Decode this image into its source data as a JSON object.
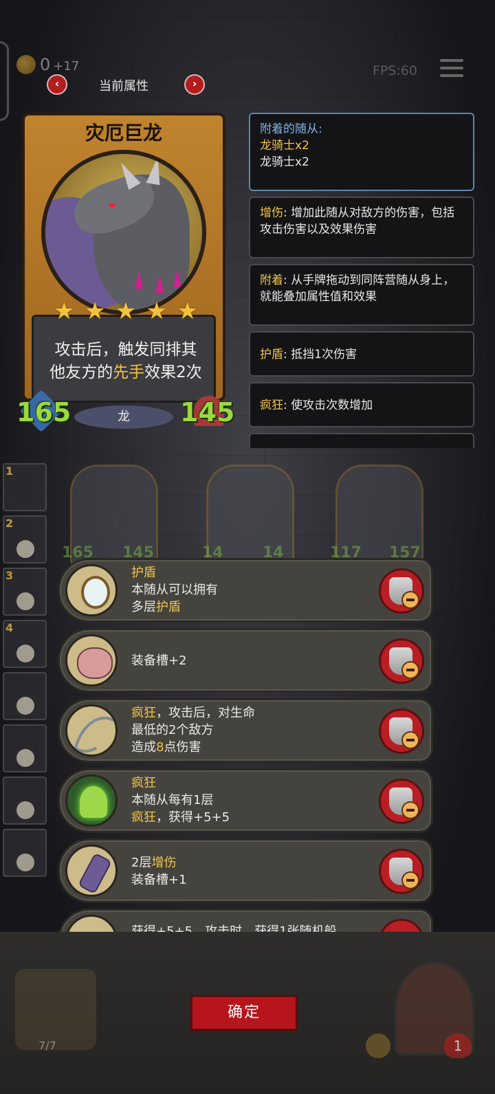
{
  "topbar": {
    "coins": "0",
    "coins_plus": "+17",
    "fps": "FPS:60"
  },
  "nav": {
    "prev": "‹",
    "title": "当前属性",
    "next": "›"
  },
  "hero": {
    "name": "灾厄巨龙",
    "stars": [
      "★",
      "★",
      "★",
      "★",
      "★"
    ],
    "desc_part1": "攻击后，触发同排其",
    "desc_part2": "他友方的",
    "desc_highlight": "先手",
    "desc_part3": "效果2次",
    "attack": "165",
    "health": "145",
    "tribe": "龙"
  },
  "info": [
    {
      "key": "附着的随从:",
      "lines": [
        "龙骑士x2",
        "龙骑士x2"
      ]
    },
    {
      "key": "增伤",
      "text": ": 增加此随从对敌方的伤害，包括攻击伤害以及效果伤害"
    },
    {
      "key": "附着",
      "text": ": 从手牌拖动到同阵营随从身上，就能叠加属性值和效果"
    },
    {
      "key": "护盾",
      "text": ": 抵挡1次伤害"
    },
    {
      "key": "疯狂",
      "text": ": 使攻击次数增加"
    }
  ],
  "team": [
    "1",
    "2",
    "3",
    "4"
  ],
  "bg_stats": [
    "165",
    "145",
    "14",
    "14",
    "117",
    "157"
  ],
  "items": [
    {
      "k1": "护盾",
      "t1": "本随从可以拥有",
      "t2a": "多层",
      "k2": "护盾"
    },
    {
      "t1": "装备槽+2"
    },
    {
      "k1": "疯狂",
      "t1a": "，攻击后，对生命",
      "t2": "最低的2个敌方",
      "t3a": "造成",
      "v": "8",
      "t3b": "点伤害"
    },
    {
      "k1": "疯狂",
      "t1": "本随从每有1层",
      "k2": "疯狂",
      "t2b": "，获得+5+5"
    },
    {
      "t1a": "2层",
      "k1": "增伤",
      "t2": "装备槽+1"
    },
    {
      "t1": "获得+5+5，攻击时，获得1张随机船"
    }
  ],
  "bottom": {
    "confirm": "确定",
    "bag_count": "7/7",
    "lives": "1"
  },
  "colors": {
    "accent_gold": "#f0c44a",
    "button_red": "#b5151b",
    "stat_green": "#9cd83e"
  }
}
